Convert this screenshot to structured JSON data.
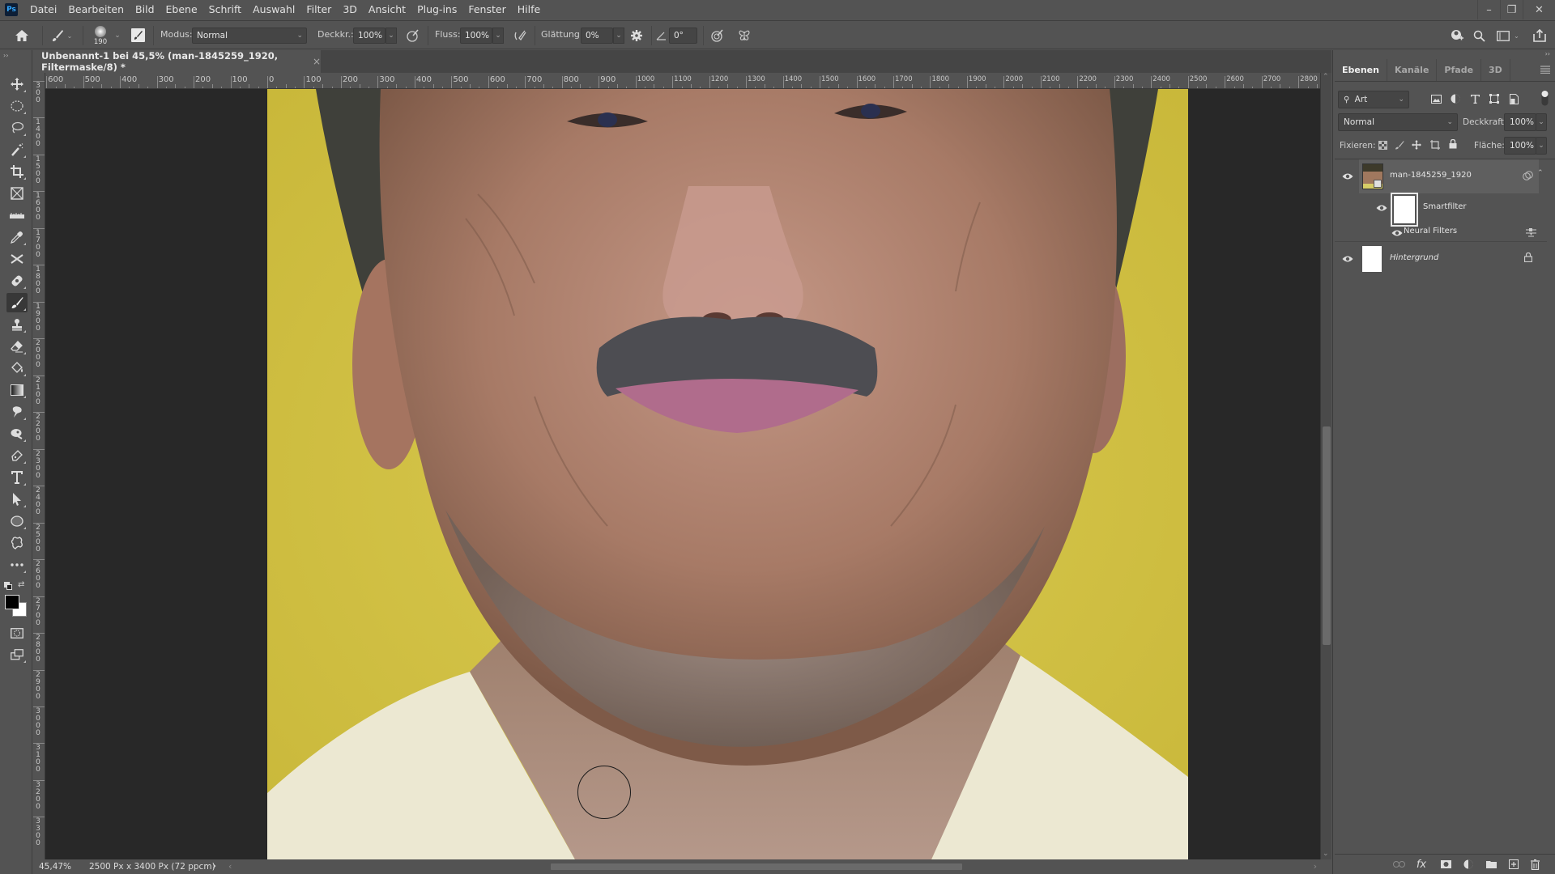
{
  "app": {
    "logo": "Ps",
    "menu": [
      "Datei",
      "Bearbeiten",
      "Bild",
      "Ebene",
      "Schrift",
      "Auswahl",
      "Filter",
      "3D",
      "Ansicht",
      "Plug-ins",
      "Fenster",
      "Hilfe"
    ],
    "window_controls": {
      "minimize": "–",
      "restore": "❐",
      "close": "✕"
    }
  },
  "options_bar": {
    "brush_size": "190",
    "mode_label": "Modus:",
    "mode_value": "Normal",
    "opacity_label": "Deckkr.:",
    "opacity_value": "100%",
    "flow_label": "Fluss:",
    "flow_value": "100%",
    "smoothing_label": "Glättung:",
    "smoothing_value": "0%",
    "angle_value": "0°"
  },
  "document": {
    "tab_title": "Unbenannt-1 bei 45,5% (man-1845259_1920, Filtermaske/8) *",
    "close_symbol": "×",
    "zoom": "45,47%",
    "dimensions": "2500 Px x 3400 Px (72 ppcm)",
    "status_arrow": "›"
  },
  "rulers": {
    "horizontal": [
      "600",
      "500",
      "400",
      "300",
      "200",
      "100",
      "0",
      "100",
      "200",
      "300",
      "400",
      "500",
      "600",
      "700",
      "800",
      "900",
      "1000",
      "1100",
      "1200",
      "1300",
      "1400",
      "1500",
      "1600",
      "1700",
      "1800",
      "1900",
      "2000",
      "2100",
      "2200",
      "2300",
      "2400",
      "2500",
      "2600",
      "2700",
      "2800"
    ],
    "vertical": [
      "300",
      "1400",
      "1500",
      "1600",
      "1700",
      "1800",
      "1900",
      "2000",
      "2100",
      "2200",
      "2300",
      "2400",
      "2500",
      "2600",
      "2700",
      "2800",
      "2900",
      "3000",
      "3100",
      "3200",
      "3300"
    ]
  },
  "tools": [
    {
      "name": "move-tool"
    },
    {
      "name": "elliptical-marquee-tool"
    },
    {
      "name": "lasso-tool"
    },
    {
      "name": "magic-wand-tool"
    },
    {
      "name": "crop-tool"
    },
    {
      "name": "frame-tool"
    },
    {
      "name": "ruler-tool"
    },
    {
      "name": "eyedropper-tool"
    },
    {
      "name": "content-aware-move-tool"
    },
    {
      "name": "healing-brush-tool"
    },
    {
      "name": "brush-tool",
      "active": true
    },
    {
      "name": "clone-stamp-tool"
    },
    {
      "name": "eraser-tool"
    },
    {
      "name": "paint-bucket-tool"
    },
    {
      "name": "gradient-tool"
    },
    {
      "name": "smudge-tool"
    },
    {
      "name": "dodge-tool"
    },
    {
      "name": "pen-tool"
    },
    {
      "name": "type-tool"
    },
    {
      "name": "path-selection-tool"
    },
    {
      "name": "ellipse-tool"
    },
    {
      "name": "custom-shape-tool"
    },
    {
      "name": "more-tools"
    }
  ],
  "colors": {
    "foreground": "#000000",
    "background": "#ffffff",
    "ui_dark": "#282828",
    "ui_panel": "#535353",
    "photo_bg_yellow": "#d3c246"
  },
  "layers_panel": {
    "tabs": [
      "Ebenen",
      "Kanäle",
      "Pfade",
      "3D"
    ],
    "active_tab": "Ebenen",
    "filter_label": "Art",
    "blend_mode": "Normal",
    "opacity_label": "Deckkraft:",
    "opacity_value": "100%",
    "lock_label": "Fixieren:",
    "fill_label": "Fläche:",
    "fill_value": "100%",
    "layers": [
      {
        "name": "man-1845259_1920",
        "visible": true,
        "type": "smart-object",
        "selected": true
      },
      {
        "name": "Smartfilter",
        "visible": true,
        "type": "smart-filter-mask"
      },
      {
        "name": "Neural Filters",
        "visible": true,
        "type": "filter"
      },
      {
        "name": "Hintergrund",
        "visible": true,
        "type": "background",
        "locked": true
      }
    ]
  }
}
